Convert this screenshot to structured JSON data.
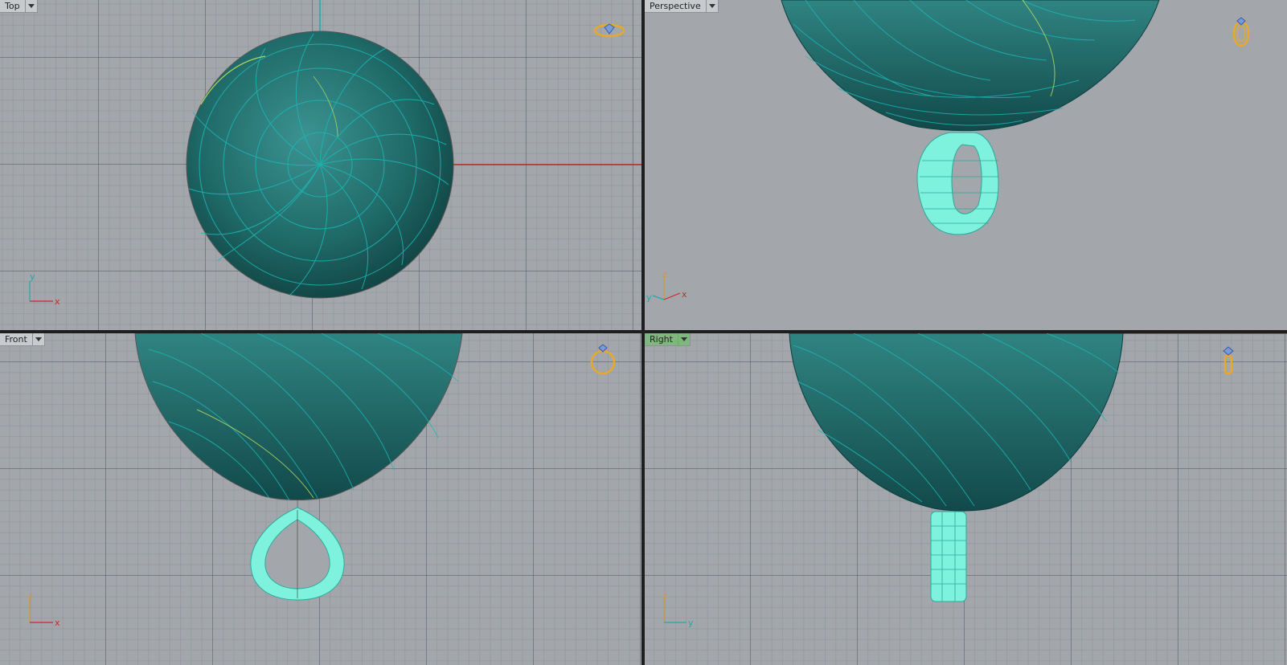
{
  "viewports": {
    "top": {
      "label": "Top"
    },
    "perspective": {
      "label": "Perspective"
    },
    "front": {
      "label": "Front"
    },
    "right": {
      "label": "Right"
    }
  },
  "axes": {
    "top": {
      "vertical": "y",
      "horizontal": "x"
    },
    "perspective": {
      "vertical": "z",
      "left": "y",
      "right": "x"
    },
    "front": {
      "vertical": "z",
      "horizontal": "x"
    },
    "right": {
      "vertical": "z",
      "horizontal": "y"
    }
  },
  "colors": {
    "viewport_bg": "#a3a7ab",
    "model_teal": "#1f6a68",
    "wire": "#22c2c0",
    "bail": "#7ff2de",
    "x_axis": "#c62a2a",
    "y_axis": "#1fa8a8",
    "z_axis": "#d29a2a",
    "active_tab": "#7fb77e",
    "ring_widget": "#e8a82a"
  },
  "icons": {
    "view_widget": "ring-navigation-icon",
    "tab_dropdown": "chevron-down-icon"
  }
}
